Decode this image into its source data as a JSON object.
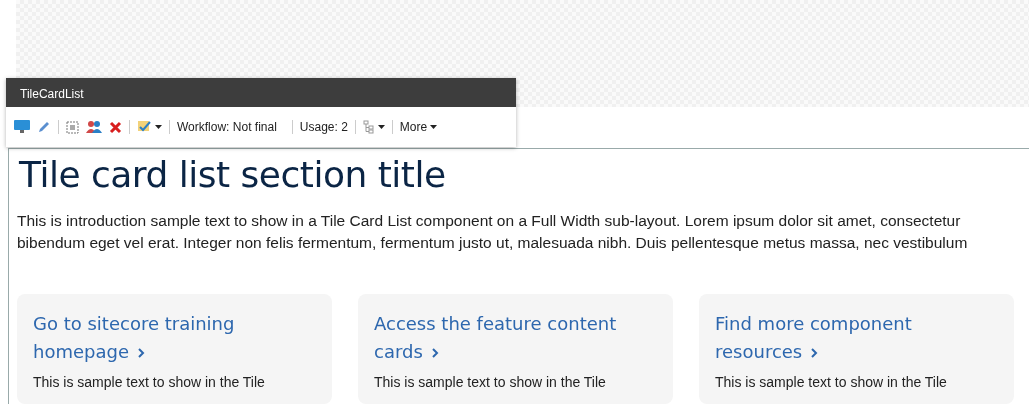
{
  "toolbar": {
    "title": "TileCardList",
    "workflow": "Workflow: Not final",
    "usage": "Usage: 2",
    "more": "More"
  },
  "section": {
    "title": "Tile card list section title",
    "intro": "This is introduction sample text to show in a Tile Card List component on a Full Width sub-layout. Lorem ipsum dolor sit amet, consectetur bibendum eget vel erat. Integer non felis fermentum, fermentum justo ut, malesuada nibh. Duis pellentesque metus massa, nec vestibulum"
  },
  "cards": [
    {
      "title": "Go to sitecore training homepage",
      "text": "This is sample text to show in the Tile"
    },
    {
      "title": "Access the feature content cards",
      "text": "This is sample text to show in the Tile"
    },
    {
      "title": "Find more component resources",
      "text": "This is sample text to show in the Tile"
    }
  ]
}
